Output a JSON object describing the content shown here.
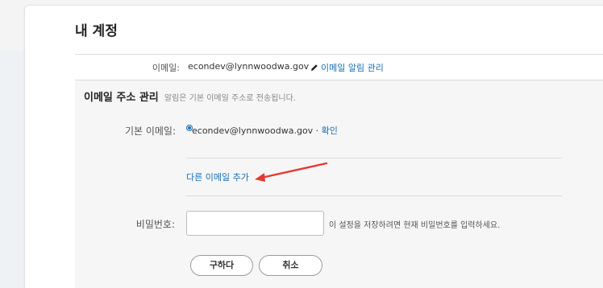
{
  "page": {
    "title": "내 계정"
  },
  "email_row": {
    "label": "이메일:",
    "value": "econdev@lynnwoodwa.gov",
    "alert_link": "이메일 알림 관리"
  },
  "email_section": {
    "title": "이메일 주소 관리",
    "subtitle": "알림은 기본 이메일 주소로 전송됩니다.",
    "primary_label": "기본 이메일:",
    "primary_value": "econdev@lynnwoodwa.gov · ",
    "confirm_link": "확인",
    "add_email_link": "다른 이메일 추가"
  },
  "password": {
    "label": "비밀번호:",
    "value": "",
    "hint": "이 설정을 저장하려면 현재 비밀번호를 입력하세요."
  },
  "buttons": {
    "submit": "구하다",
    "cancel": "취소"
  },
  "colors": {
    "link": "#1a6fb5",
    "annotation_arrow": "#e53935"
  },
  "icons": {
    "edit": "pencil-icon",
    "annotation": "red-arrow-annotation"
  }
}
